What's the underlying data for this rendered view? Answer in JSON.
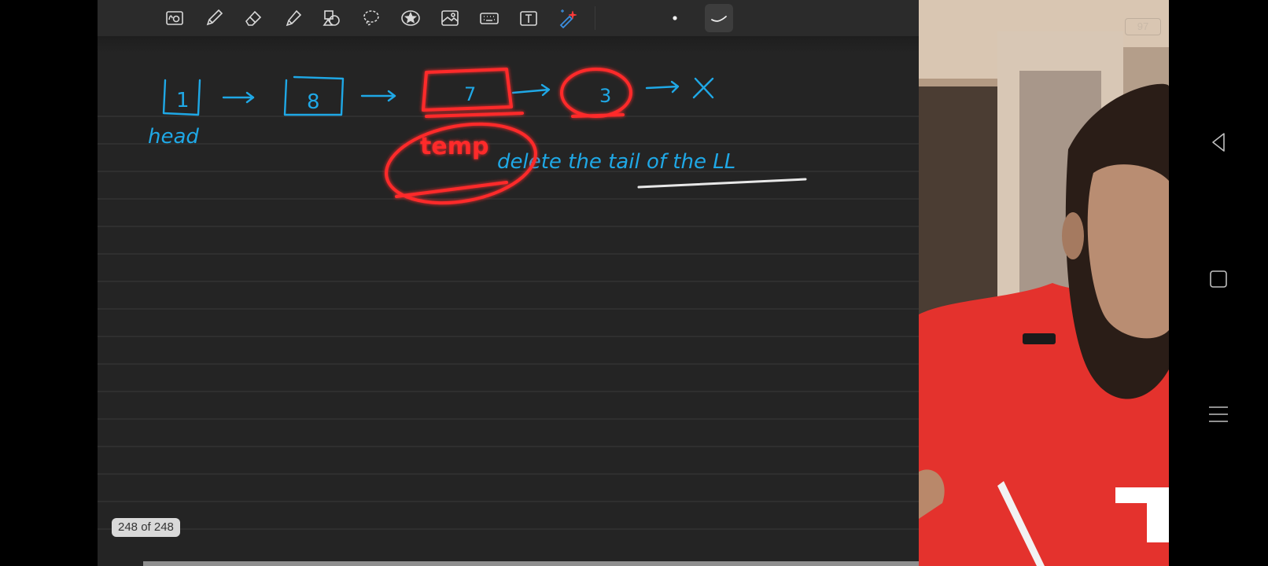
{
  "notes_app": {
    "toolbar": {
      "tools": [
        {
          "name": "zoom-window-icon",
          "interactable": true
        },
        {
          "name": "pen-icon",
          "interactable": true
        },
        {
          "name": "eraser-icon",
          "interactable": true
        },
        {
          "name": "highlighter-icon",
          "interactable": true
        },
        {
          "name": "shapes-icon",
          "interactable": true
        },
        {
          "name": "lasso-icon",
          "interactable": true
        },
        {
          "name": "sticker-icon",
          "interactable": true
        },
        {
          "name": "image-icon",
          "interactable": true
        },
        {
          "name": "keyboard-icon",
          "interactable": true
        },
        {
          "name": "text-box-icon",
          "interactable": true
        },
        {
          "name": "laser-pointer-icon",
          "interactable": true
        }
      ],
      "stroke_size_dot": "small-dot",
      "stroke_style_active": "curve-stroke-icon"
    },
    "handwriting": {
      "nodes": [
        "1",
        "8",
        "7",
        "3"
      ],
      "null_marker": "X",
      "head_label": "head",
      "temp_label": "temp",
      "instruction": "delete the tail of the LL",
      "ink_color": "#1fa8e6",
      "highlight_color": "#ff1a1a"
    },
    "page_counter": "248 of 248"
  },
  "webcam": {
    "badge": "97"
  },
  "android_nav": {
    "back": "back-icon",
    "home": "recent-apps-icon",
    "menu": "menu-icon"
  }
}
